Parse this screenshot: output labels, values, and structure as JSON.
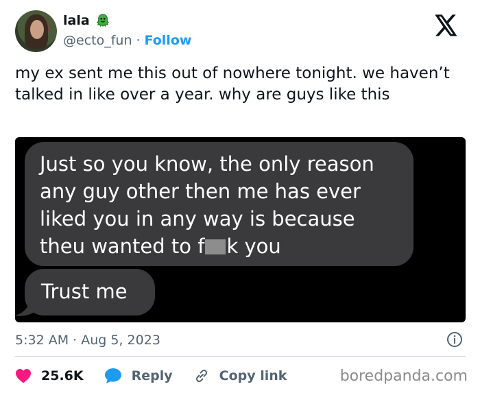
{
  "author": {
    "name": "lala",
    "handle": "@ecto_fun",
    "separator": "·",
    "follow_label": "Follow"
  },
  "icons": {
    "badge": "ecto-ghost-badge-icon",
    "logo": "x-logo-icon",
    "info": "info-icon",
    "like": "heart-icon",
    "reply": "speech-bubble-icon",
    "copy": "link-icon"
  },
  "colors": {
    "accent": "#1d9bf0",
    "like": "#f91880",
    "bubble": "#3a3a3c"
  },
  "tweet": {
    "text": "my ex sent me this out of nowhere tonight. we haven’t talked in like over a year. why are guys like this"
  },
  "media": {
    "message1": {
      "line1": "Just so you know, the only reason",
      "line2": "any guy other then me has ever",
      "line3": "liked you in any way is because",
      "line4_before": "theu wanted to f",
      "line4_after": "k you"
    },
    "message2": "Trust me"
  },
  "meta": {
    "time": "5:32 AM",
    "separator": "·",
    "date": "Aug 5, 2023"
  },
  "actions": {
    "likes": "25.6K",
    "reply_label": "Reply",
    "copy_label": "Copy link"
  },
  "watermark": "boredpanda.com"
}
